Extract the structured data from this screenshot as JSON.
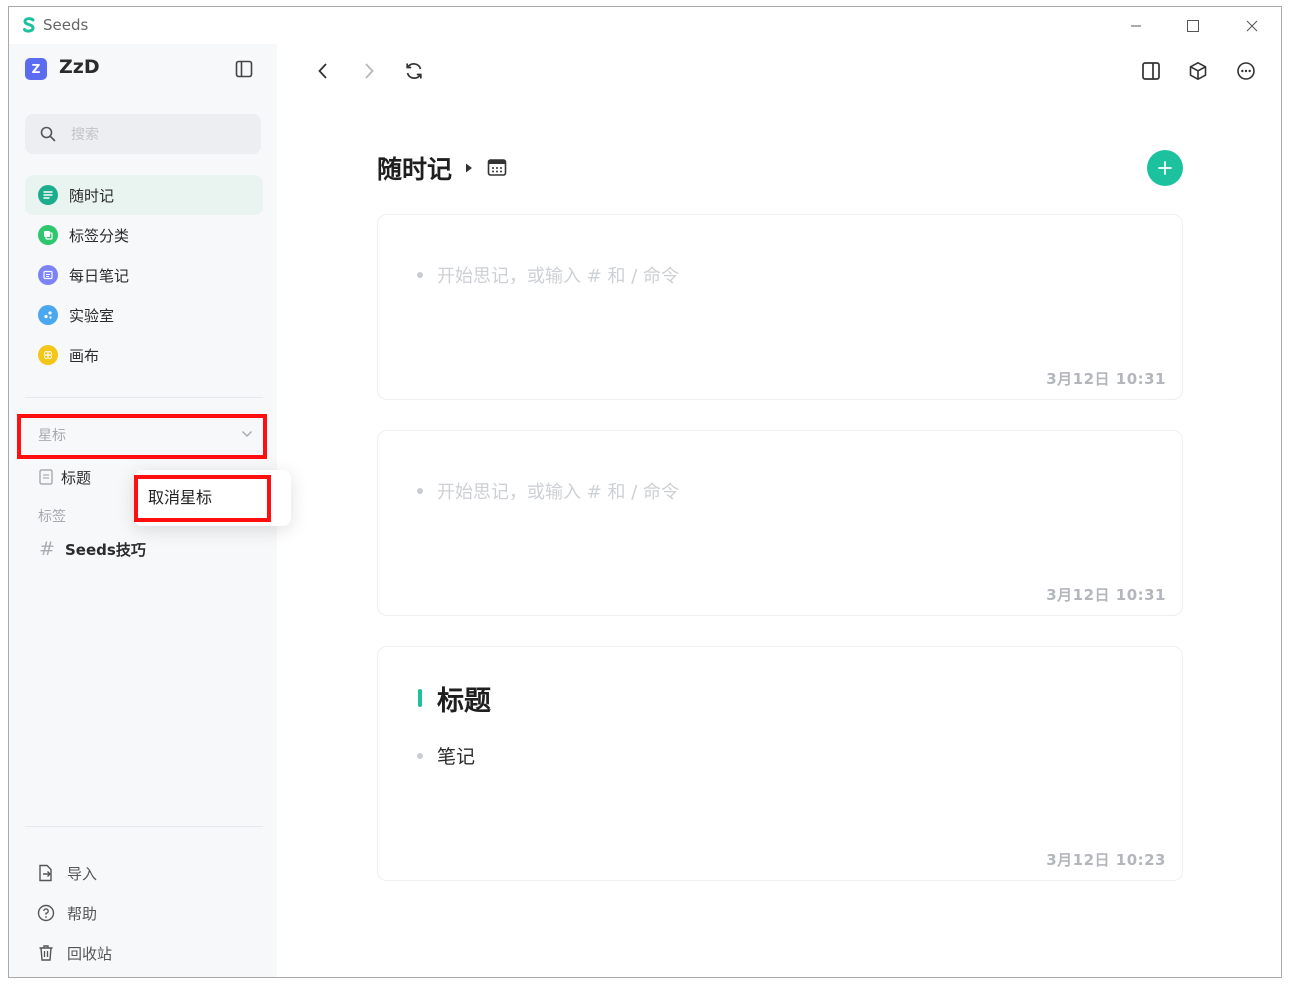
{
  "app": {
    "name": "Seeds"
  },
  "workspace": {
    "badge": "Z",
    "name": "ZzD"
  },
  "search": {
    "placeholder": "搜索"
  },
  "nav": [
    {
      "label": "随时记",
      "icon": "list-icon",
      "color": "#1cad8c",
      "active": true
    },
    {
      "label": "标签分类",
      "icon": "tag-category-icon",
      "color": "#2ec770"
    },
    {
      "label": "每日笔记",
      "icon": "daily-note-icon",
      "color": "#7b83f5"
    },
    {
      "label": "实验室",
      "icon": "lab-icon",
      "color": "#4aa8f0"
    },
    {
      "label": "画布",
      "icon": "canvas-icon",
      "color": "#f5c518"
    }
  ],
  "starred": {
    "label": "星标",
    "items": [
      {
        "label": "标题"
      }
    ]
  },
  "tags": {
    "label": "标签",
    "items": [
      {
        "label": "Seeds技巧"
      }
    ]
  },
  "bottom": [
    {
      "label": "导入",
      "icon": "import-icon"
    },
    {
      "label": "帮助",
      "icon": "help-icon"
    },
    {
      "label": "回收站",
      "icon": "trash-icon"
    }
  ],
  "context_menu": {
    "item": "取消星标"
  },
  "main": {
    "title": "随时记",
    "cards": [
      {
        "placeholder": "开始思记，或输入 # 和 / 命令",
        "time": "3月12日 10:31"
      },
      {
        "placeholder": "开始思记，或输入 # 和 / 命令",
        "time": "3月12日 10:31"
      },
      {
        "heading": "标题",
        "body": "笔记",
        "time": "3月12日 10:23"
      }
    ]
  },
  "colors": {
    "accent": "#1cc19e",
    "highlight": "#ff0f0f"
  }
}
